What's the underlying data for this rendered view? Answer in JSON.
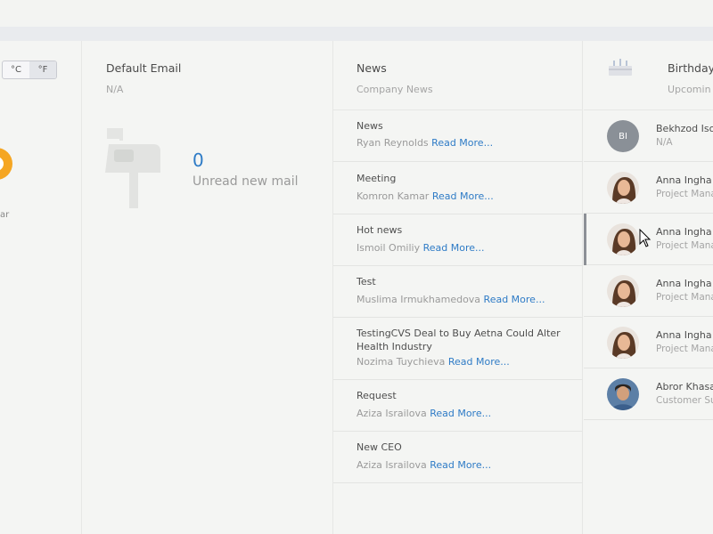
{
  "weather": {
    "unit_c": "°C",
    "unit_f": "°F",
    "condition_fragment": "ar"
  },
  "email": {
    "title": "Default Email",
    "address": "N/A",
    "unread_count": "0",
    "unread_label": "Unread new mail"
  },
  "news": {
    "title": "News",
    "subtitle": "Company News",
    "read_more": "Read More...",
    "items": [
      {
        "title": "News",
        "author": "Ryan Reynolds"
      },
      {
        "title": "Meeting",
        "author": "Komron Kamar"
      },
      {
        "title": "Hot news",
        "author": "Ismoil Omiliy"
      },
      {
        "title": "Test",
        "author": "Muslima Irmukhamedova"
      },
      {
        "title": "TestingCVS Deal to Buy Aetna Could Alter Health Industry",
        "author": "Nozima Tuychieva"
      },
      {
        "title": "Request",
        "author": "Aziza Israilova"
      },
      {
        "title": "New CEO",
        "author": "Aziza Israilova"
      }
    ]
  },
  "birthdays": {
    "title": "Birthday",
    "subtitle": "Upcomin",
    "people": [
      {
        "name": "Bekhzod Iso",
        "role": "N/A",
        "initials": "BI"
      },
      {
        "name": "Anna Ingha",
        "role": "Project Mana"
      },
      {
        "name": "Anna Ingha",
        "role": "Project Mana"
      },
      {
        "name": "Anna Ingha",
        "role": "Project Mana"
      },
      {
        "name": "Anna Ingha",
        "role": "Project Mana"
      },
      {
        "name": "Abror Khasa",
        "role": "Customer Su"
      }
    ]
  },
  "colors": {
    "link": "#2e7bc6",
    "sun": "#f5a623",
    "background": "#f3f4f2"
  }
}
